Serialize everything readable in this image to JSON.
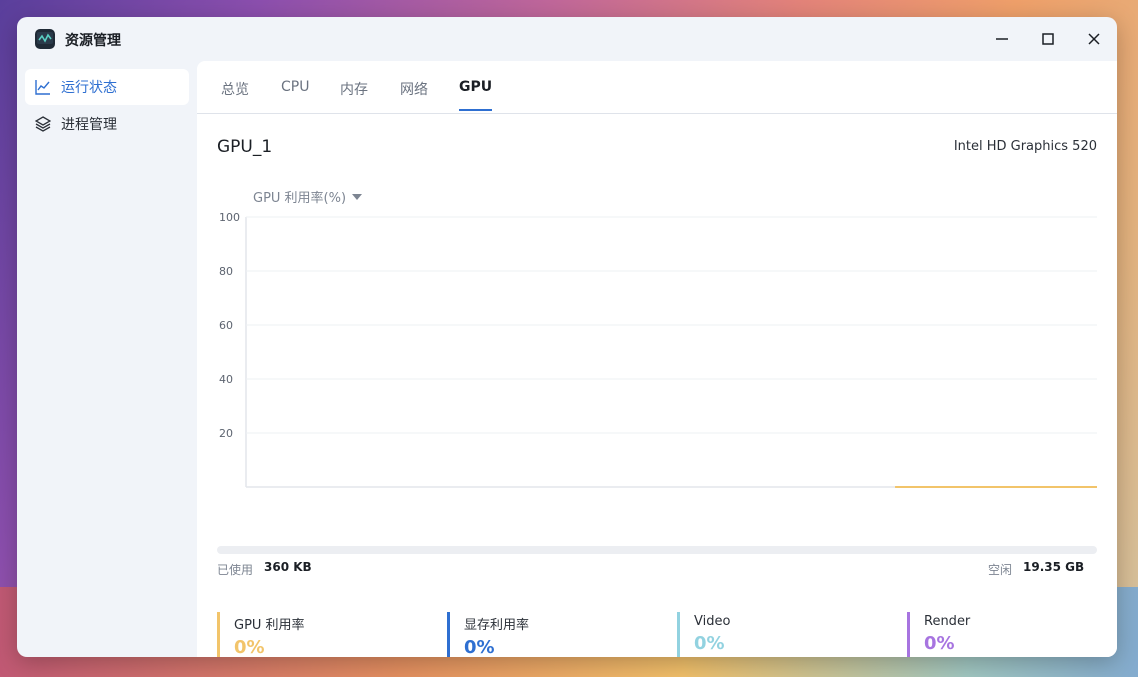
{
  "app": {
    "title": "资源管理"
  },
  "sidebar": {
    "items": [
      {
        "label": "运行状态",
        "icon": "line-chart-icon",
        "active": true
      },
      {
        "label": "进程管理",
        "icon": "layers-icon",
        "active": false
      }
    ]
  },
  "tabs": [
    {
      "label": "总览"
    },
    {
      "label": "CPU"
    },
    {
      "label": "内存"
    },
    {
      "label": "网络"
    },
    {
      "label": "GPU",
      "active": true
    }
  ],
  "gpu": {
    "name": "GPU_1",
    "model": "Intel HD Graphics 520",
    "metric_selected": "GPU 利用率(%)"
  },
  "chart_data": {
    "type": "line",
    "y_ticks": [
      "100",
      "80",
      "60",
      "40",
      "20"
    ],
    "ylim": [
      0,
      100
    ],
    "series": [
      {
        "values": [
          0,
          0,
          0,
          0,
          0,
          0,
          0,
          0,
          0,
          0,
          0,
          0,
          0,
          0,
          0,
          0,
          0,
          0,
          0,
          0,
          0,
          0,
          0,
          0,
          0,
          0,
          0,
          0,
          0,
          0,
          0,
          0,
          0,
          0,
          0,
          0,
          0,
          0,
          0,
          0,
          0,
          0,
          0,
          0,
          0,
          0,
          0,
          0,
          0,
          0,
          0,
          0,
          0,
          0,
          0,
          0,
          0,
          0,
          0,
          0
        ],
        "color": "#f2c46a"
      }
    ],
    "visible_from_index": 45,
    "grid": true
  },
  "memory": {
    "used_label": "已使用",
    "used_value": "360 KB",
    "free_label": "空闲",
    "free_value": "19.35 GB",
    "used_fraction": 0.0
  },
  "stats": [
    {
      "name": "GPU 利用率",
      "value": "0%",
      "color": "#f2c46a"
    },
    {
      "name": "显存利用率",
      "value": "0%",
      "color": "#2e6fd1"
    },
    {
      "name": "Video",
      "value": "0%",
      "color": "#92d2e0"
    },
    {
      "name": "Render",
      "value": "0%",
      "color": "#a774e0"
    }
  ]
}
